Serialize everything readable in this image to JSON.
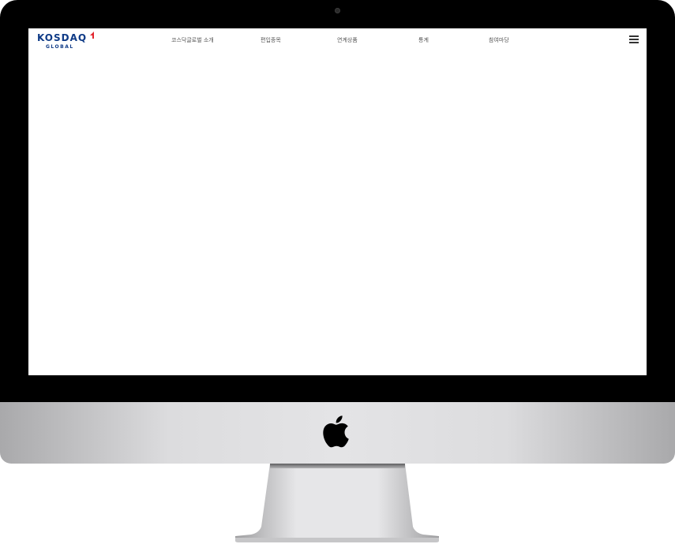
{
  "site": {
    "logo": {
      "main_text": "KOSDAQ",
      "sub_text": "GLOBAL"
    },
    "nav": {
      "items": [
        {
          "label": "코스닥글로벌 소개"
        },
        {
          "label": "편입종목"
        },
        {
          "label": "연계상품"
        },
        {
          "label": "통계"
        },
        {
          "label": "참여마당"
        }
      ]
    },
    "menu_icon": "hamburger-menu-icon"
  },
  "device": {
    "logo_icon": "apple-logo-icon"
  },
  "colors": {
    "brand_blue": "#0e3a86",
    "brand_red": "#e3262e",
    "bezel": "#000000",
    "chin": "#e4e4e6"
  }
}
